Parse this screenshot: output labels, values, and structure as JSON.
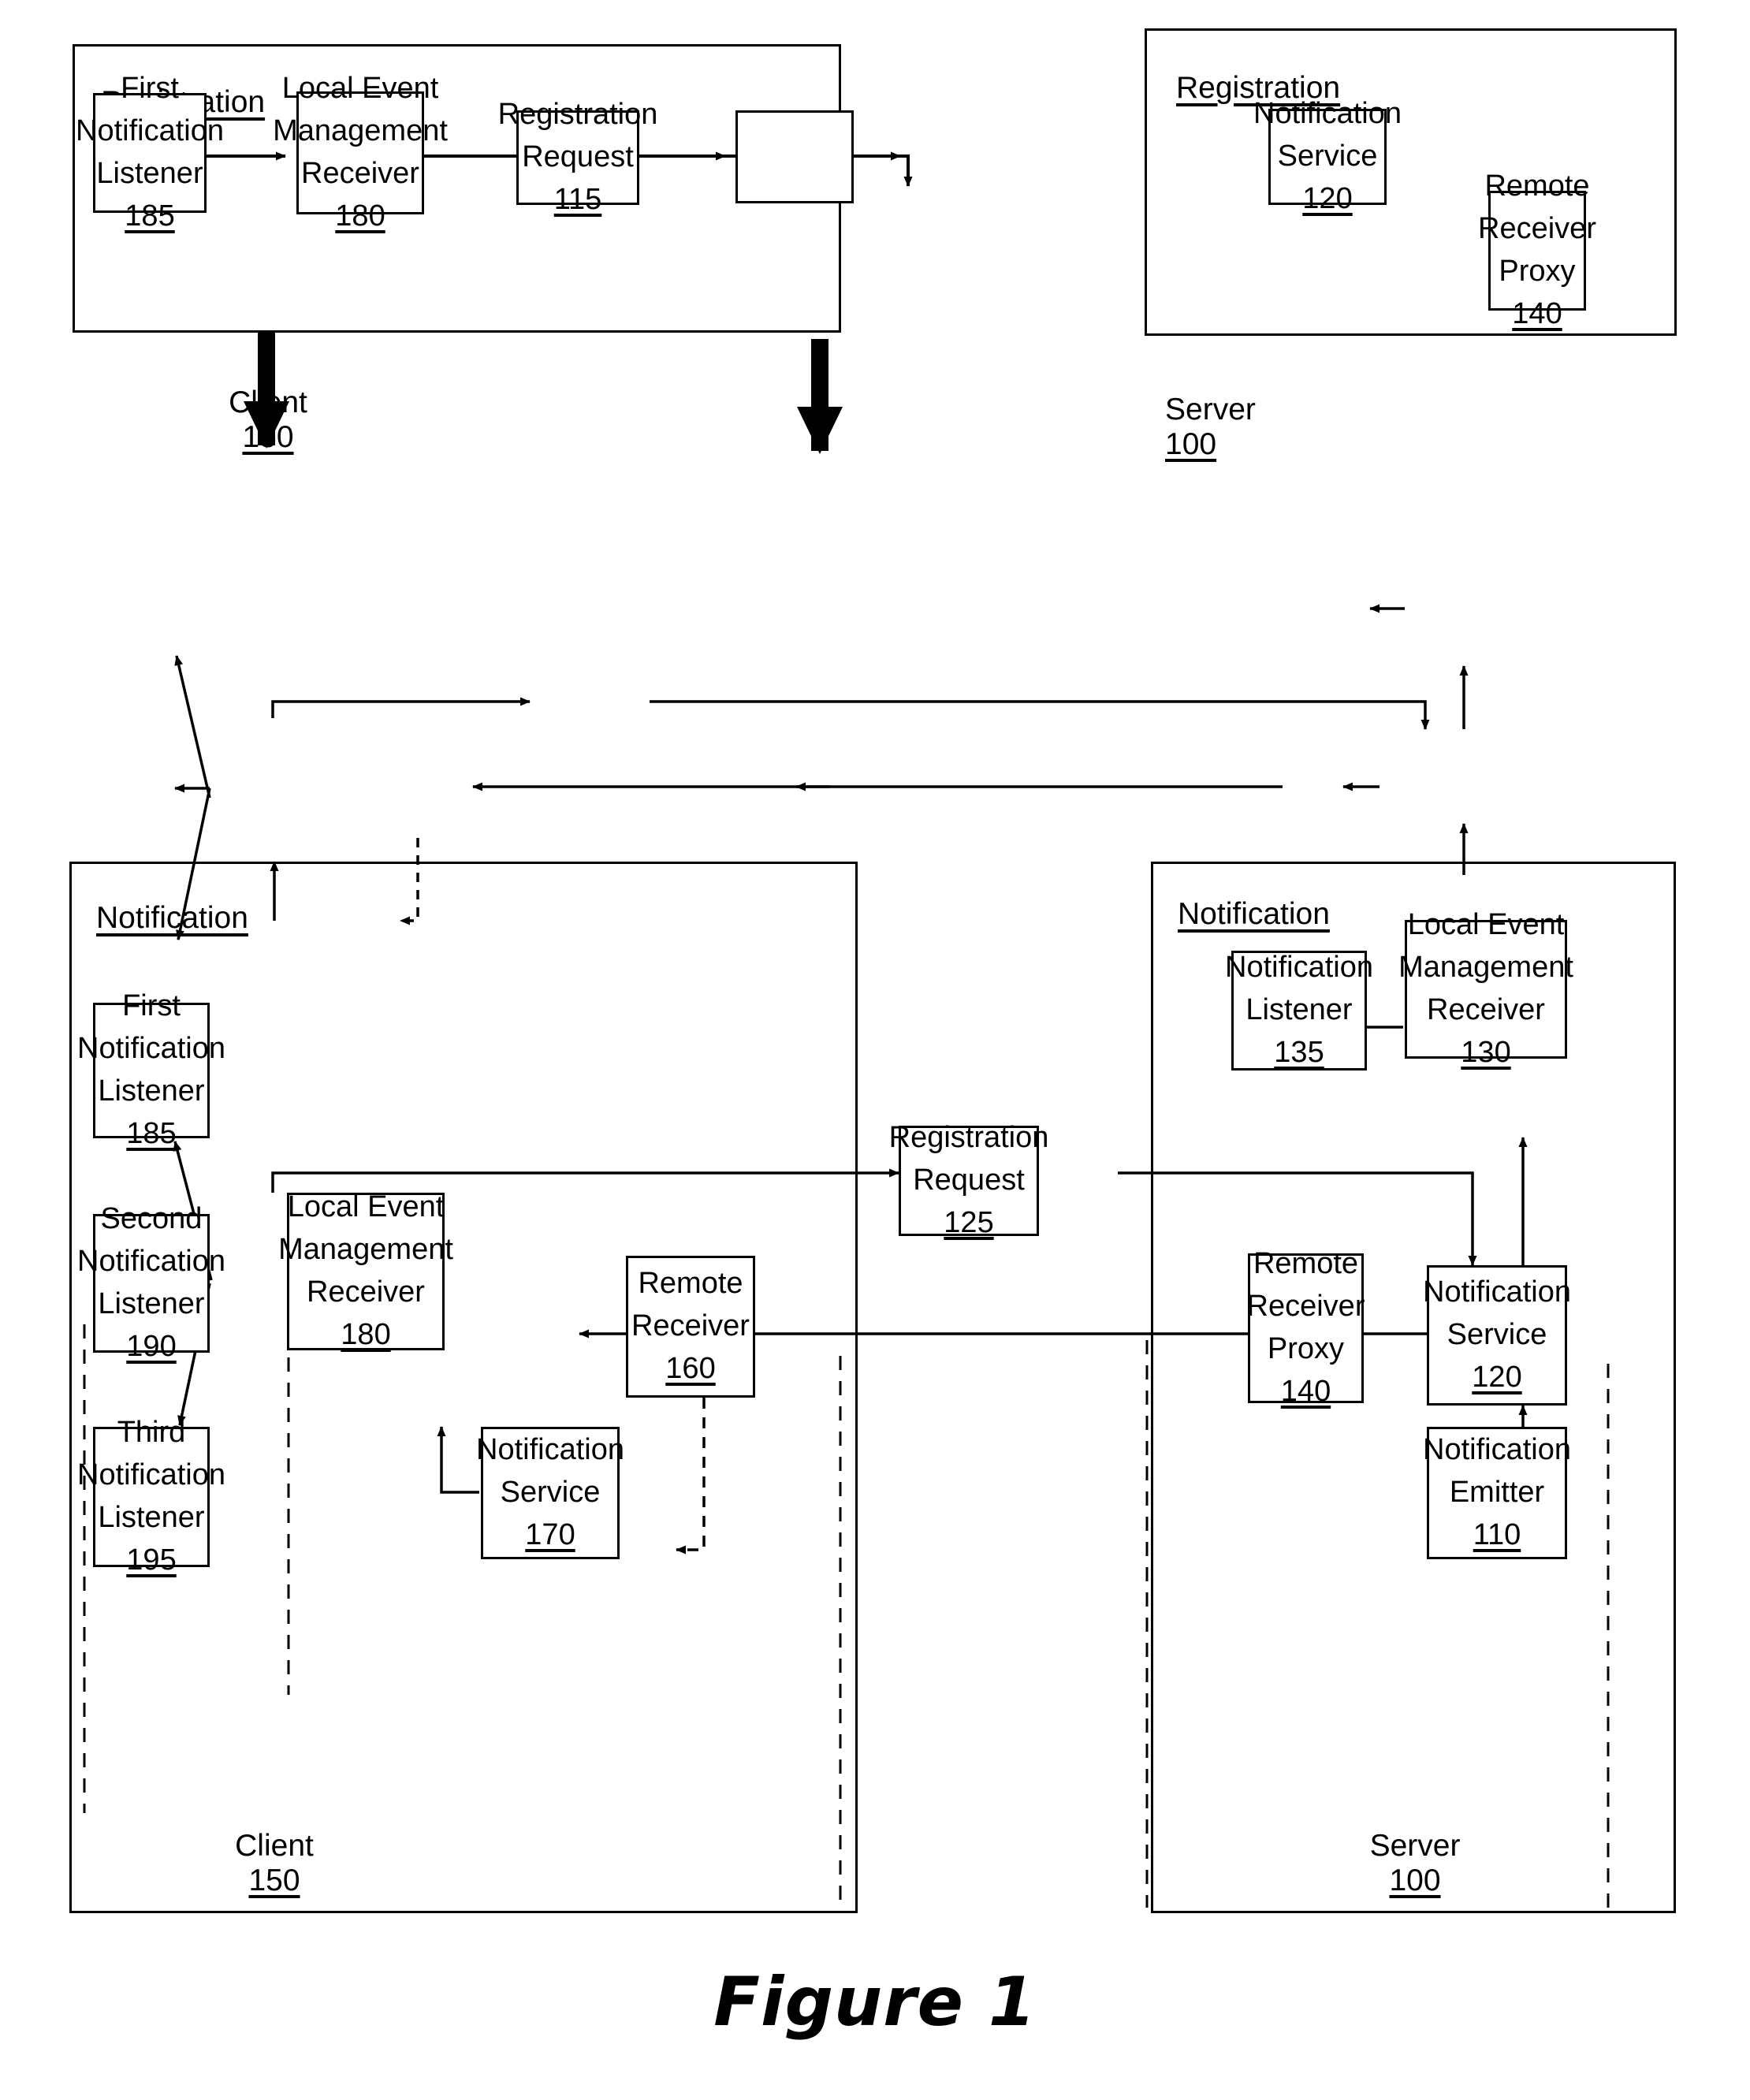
{
  "figure": {
    "caption": "Figure 1"
  },
  "panels": {
    "client_registration": {
      "title": "Registration",
      "footer_label": "Client",
      "footer_ref": "150"
    },
    "server_registration": {
      "title": "Registration",
      "footer_label": "Server",
      "footer_ref": "100"
    },
    "client_notification": {
      "title": "Notification",
      "footer_label": "Client",
      "footer_ref": "150"
    },
    "server_notification": {
      "title": "Notification",
      "footer_label": "Server",
      "footer_ref": "100"
    }
  },
  "boxes": {
    "reg_first_notification_listener": {
      "lines": [
        "First",
        "Notification",
        "Listener"
      ],
      "ref": "185"
    },
    "reg_local_event_management_receiver": {
      "lines": [
        "Local Event",
        "Management",
        "Receiver"
      ],
      "ref": "180"
    },
    "reg_registration_request": {
      "lines": [
        "Registration",
        "Request"
      ],
      "ref": "115"
    },
    "reg_notification_service": {
      "lines": [
        "Notification",
        "Service"
      ],
      "ref": "120"
    },
    "reg_remote_receiver_proxy": {
      "lines": [
        "Remote",
        "Receiver",
        "Proxy"
      ],
      "ref": "140"
    },
    "notif_first_notification_listener": {
      "lines": [
        "First",
        "Notification",
        "Listener"
      ],
      "ref": "185"
    },
    "notif_second_notification_listener": {
      "lines": [
        "Second",
        "Notification",
        "Listener"
      ],
      "ref": "190"
    },
    "notif_third_notification_listener": {
      "lines": [
        "Third",
        "Notification",
        "Listener"
      ],
      "ref": "195"
    },
    "notif_local_event_management_receiver": {
      "lines": [
        "Local Event",
        "Management",
        "Receiver"
      ],
      "ref": "180"
    },
    "notif_notification_service_client": {
      "lines": [
        "Notification",
        "Service"
      ],
      "ref": "170"
    },
    "notif_remote_receiver": {
      "lines": [
        "Remote",
        "Receiver"
      ],
      "ref": "160"
    },
    "notif_registration_request": {
      "lines": [
        "Registration",
        "Request"
      ],
      "ref": "125"
    },
    "notif_notification_listener_server": {
      "lines": [
        "Notification",
        "Listener"
      ],
      "ref": "135"
    },
    "notif_local_event_management_receiver_server": {
      "lines": [
        "Local Event",
        "Management",
        "Receiver"
      ],
      "ref": "130"
    },
    "notif_remote_receiver_proxy": {
      "lines": [
        "Remote",
        "Receiver",
        "Proxy"
      ],
      "ref": "140"
    },
    "notif_notification_service_server": {
      "lines": [
        "Notification",
        "Service"
      ],
      "ref": "120"
    },
    "notif_notification_emitter": {
      "lines": [
        "Notification",
        "Emitter"
      ],
      "ref": "110"
    }
  },
  "colors": {
    "stroke": "#000000",
    "background": "#ffffff"
  }
}
